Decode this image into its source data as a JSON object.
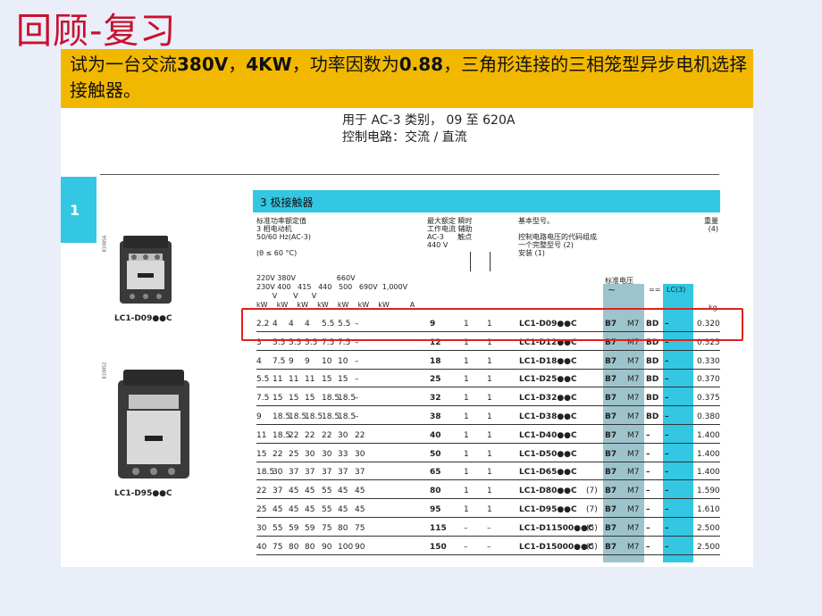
{
  "slide": {
    "title": "回顾-复习",
    "question_parts": [
      "试为一台交流",
      "380V",
      "，",
      "4KW",
      "，功率因数为",
      "0.88",
      "，三角形连接的三相笼型异步电机选择接触器。"
    ]
  },
  "catalog": {
    "header_line1": "用于 AC-3 类别， 09 至 620A",
    "header_line2": "控制电路：交流 / 直流",
    "section_number": "1",
    "section_title": "3 极接触器",
    "col_power_header": "标准功率额定值\n3 相电动机\n50/60 Hz(AC-3)\n\n(θ ≤ 60 °C)",
    "col_current_header": "最大额定 瞬时\n工作电流 辅助\nAC-3      触点\n440 V",
    "col_model_header": "基本型号。\n\n控制电路电压的代码组成\n一个完整型号 (2)\n安装 (1)",
    "col_weight_header": "重量\n(4)",
    "voltage_row1": "220V 380V                  660V",
    "voltage_row2": "230V 400   415   440   500   690V  1,000V",
    "voltage_row3": "       V       V      V",
    "unit_row": "kW    kW    kW    kW    kW    kW    kW         A",
    "std_voltage_label": "标准电压",
    "ac_symbol": "~",
    "dc_symbol": "==",
    "lc3_label": "LC(3)",
    "kg_label": "kg",
    "product1_label": "LC1-D09●●C",
    "product2_label": "LC1-D95●●C",
    "photo1_code": "810856",
    "photo2_code": "810852",
    "rows": [
      {
        "p": [
          "2.2",
          "4",
          "4",
          "4",
          "5.5",
          "5.5",
          "–"
        ],
        "a": "9",
        "c1": "1",
        "c2": "1",
        "model": "LC1-D09●●C",
        "note": "",
        "v1": "B7",
        "v2": "M7",
        "v3": "BD",
        "v4": "–",
        "w": "0.320"
      },
      {
        "p": [
          "3",
          "5.5",
          "5.5",
          "5.5",
          "7.5",
          "7.5",
          "–"
        ],
        "a": "12",
        "c1": "1",
        "c2": "1",
        "model": "LC1-D12●●C",
        "note": "",
        "v1": "B7",
        "v2": "M7",
        "v3": "BD",
        "v4": "–",
        "w": "0.325"
      },
      {
        "p": [
          "4",
          "7.5",
          "9",
          "9",
          "10",
          "10",
          "–"
        ],
        "a": "18",
        "c1": "1",
        "c2": "1",
        "model": "LC1-D18●●C",
        "note": "",
        "v1": "B7",
        "v2": "M7",
        "v3": "BD",
        "v4": "–",
        "w": "0.330"
      },
      {
        "p": [
          "5.5",
          "11",
          "11",
          "11",
          "15",
          "15",
          "–"
        ],
        "a": "25",
        "c1": "1",
        "c2": "1",
        "model": "LC1-D25●●C",
        "note": "",
        "v1": "B7",
        "v2": "M7",
        "v3": "BD",
        "v4": "–",
        "w": "0.370"
      },
      {
        "p": [
          "7.5",
          "15",
          "15",
          "15",
          "18.5",
          "18.5",
          "–"
        ],
        "a": "32",
        "c1": "1",
        "c2": "1",
        "model": "LC1-D32●●C",
        "note": "",
        "v1": "B7",
        "v2": "M7",
        "v3": "BD",
        "v4": "–",
        "w": "0.375"
      },
      {
        "p": [
          "9",
          "18.5",
          "18.5",
          "18.5",
          "18.5",
          "18.5",
          "–"
        ],
        "a": "38",
        "c1": "1",
        "c2": "1",
        "model": "LC1-D38●●C",
        "note": "",
        "v1": "B7",
        "v2": "M7",
        "v3": "BD",
        "v4": "–",
        "w": "0.380"
      },
      {
        "p": [
          "11",
          "18.5",
          "22",
          "22",
          "22",
          "30",
          "22"
        ],
        "a": "40",
        "c1": "1",
        "c2": "1",
        "model": "LC1-D40●●C",
        "note": "",
        "v1": "B7",
        "v2": "M7",
        "v3": "–",
        "v4": "–",
        "w": "1.400"
      },
      {
        "p": [
          "15",
          "22",
          "25",
          "30",
          "30",
          "33",
          "30"
        ],
        "a": "50",
        "c1": "1",
        "c2": "1",
        "model": "LC1-D50●●C",
        "note": "",
        "v1": "B7",
        "v2": "M7",
        "v3": "–",
        "v4": "–",
        "w": "1.400"
      },
      {
        "p": [
          "18.5",
          "30",
          "37",
          "37",
          "37",
          "37",
          "37"
        ],
        "a": "65",
        "c1": "1",
        "c2": "1",
        "model": "LC1-D65●●C",
        "note": "",
        "v1": "B7",
        "v2": "M7",
        "v3": "–",
        "v4": "–",
        "w": "1.400"
      },
      {
        "p": [
          "22",
          "37",
          "45",
          "45",
          "55",
          "45",
          "45"
        ],
        "a": "80",
        "c1": "1",
        "c2": "1",
        "model": "LC1-D80●●C",
        "note": "(7)",
        "v1": "B7",
        "v2": "M7",
        "v3": "–",
        "v4": "–",
        "w": "1.590"
      },
      {
        "p": [
          "25",
          "45",
          "45",
          "45",
          "55",
          "45",
          "45"
        ],
        "a": "95",
        "c1": "1",
        "c2": "1",
        "model": "LC1-D95●●C",
        "note": "(7)",
        "v1": "B7",
        "v2": "M7",
        "v3": "–",
        "v4": "–",
        "w": "1.610"
      },
      {
        "p": [
          "30",
          "55",
          "59",
          "59",
          "75",
          "80",
          "75"
        ],
        "a": "115",
        "c1": "–",
        "c2": "–",
        "model": "LC1-D11500●●C",
        "note": "(5)",
        "v1": "B7",
        "v2": "M7",
        "v3": "–",
        "v4": "–",
        "w": "2.500"
      },
      {
        "p": [
          "40",
          "75",
          "80",
          "80",
          "90",
          "100",
          "90"
        ],
        "a": "150",
        "c1": "–",
        "c2": "–",
        "model": "LC1-D15000●●C",
        "note": "(5)",
        "v1": "B7",
        "v2": "M7",
        "v3": "–",
        "v4": "–",
        "w": "2.500"
      }
    ]
  },
  "colors": {
    "title": "#c8102e",
    "banner": "#f2b800",
    "accent": "#33c7e3",
    "highlight": "#e0211b"
  }
}
